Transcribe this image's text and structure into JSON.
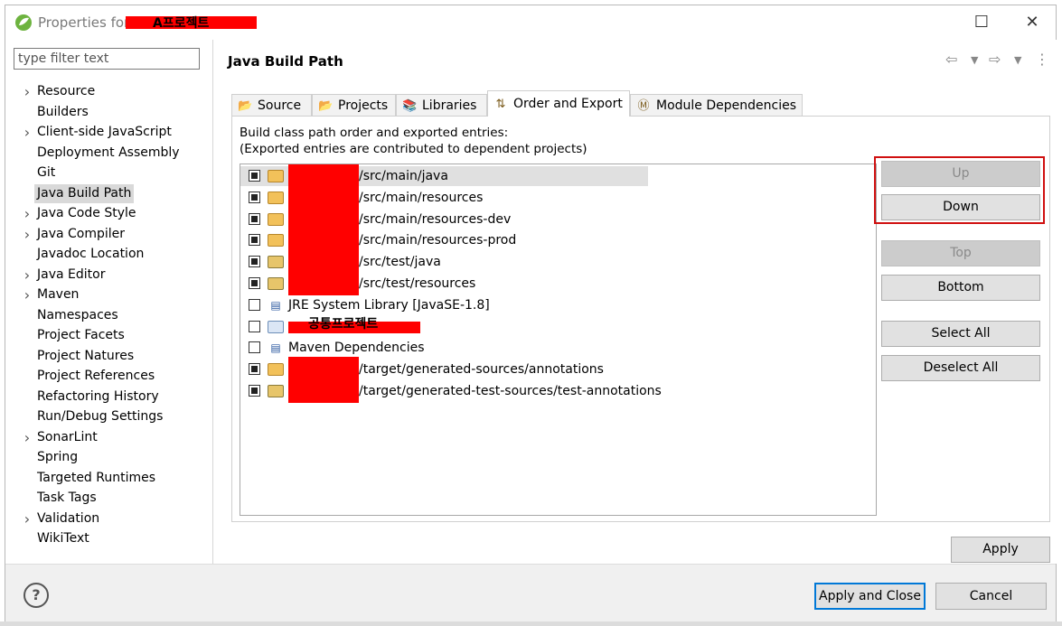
{
  "window": {
    "title_prefix": "Properties for",
    "title_project": "A프로젝트",
    "maximize_icon": "maximize-icon",
    "close_icon": "close-icon"
  },
  "filter": {
    "placeholder": "type filter text"
  },
  "nav": [
    {
      "label": "Resource",
      "expandable": true
    },
    {
      "label": "Builders",
      "expandable": false
    },
    {
      "label": "Client-side JavaScript",
      "expandable": true
    },
    {
      "label": "Deployment Assembly",
      "expandable": false
    },
    {
      "label": "Git",
      "expandable": false
    },
    {
      "label": "Java Build Path",
      "expandable": false,
      "selected": true
    },
    {
      "label": "Java Code Style",
      "expandable": true
    },
    {
      "label": "Java Compiler",
      "expandable": true
    },
    {
      "label": "Javadoc Location",
      "expandable": false
    },
    {
      "label": "Java Editor",
      "expandable": true
    },
    {
      "label": "Maven",
      "expandable": true
    },
    {
      "label": "Namespaces",
      "expandable": false
    },
    {
      "label": "Project Facets",
      "expandable": false
    },
    {
      "label": "Project Natures",
      "expandable": false
    },
    {
      "label": "Project References",
      "expandable": false
    },
    {
      "label": "Refactoring History",
      "expandable": false
    },
    {
      "label": "Run/Debug Settings",
      "expandable": false
    },
    {
      "label": "SonarLint",
      "expandable": true
    },
    {
      "label": "Spring",
      "expandable": false
    },
    {
      "label": "Targeted Runtimes",
      "expandable": false
    },
    {
      "label": "Task Tags",
      "expandable": false
    },
    {
      "label": "Validation",
      "expandable": true
    },
    {
      "label": "WikiText",
      "expandable": false
    }
  ],
  "page": {
    "title": "Java Build Path"
  },
  "tabs": [
    {
      "label": "Source",
      "icon": "source-folder-icon"
    },
    {
      "label": "Projects",
      "icon": "projects-icon"
    },
    {
      "label": "Libraries",
      "icon": "libraries-icon"
    },
    {
      "label": "Order and Export",
      "icon": "order-export-icon",
      "active": true
    },
    {
      "label": "Module Dependencies",
      "icon": "module-icon"
    }
  ],
  "order_export": {
    "desc1": "Build class path order and exported entries:",
    "desc2": "(Exported entries are contributed to dependent projects)",
    "entries": [
      {
        "text": "/src/main/java",
        "checked": true,
        "icon": "source-folder-icon",
        "redacted": true,
        "selected": true
      },
      {
        "text": "/src/main/resources",
        "checked": true,
        "icon": "source-folder-icon",
        "redacted": true
      },
      {
        "text": "/src/main/resources-dev",
        "checked": true,
        "icon": "source-folder-icon",
        "redacted": true
      },
      {
        "text": "/src/main/resources-prod",
        "checked": true,
        "icon": "source-folder-icon",
        "redacted": true
      },
      {
        "text": "/src/test/java",
        "checked": true,
        "icon": "test-source-folder-icon",
        "redacted": true
      },
      {
        "text": "/src/test/resources",
        "checked": true,
        "icon": "test-source-folder-icon",
        "redacted": true
      },
      {
        "text": "JRE System Library [JavaSE-1.8]",
        "checked": false,
        "icon": "library-icon",
        "redacted": false
      },
      {
        "text": "공통프로젝트",
        "checked": false,
        "icon": "project-folder-icon",
        "redacted": true,
        "label_over_redaction": true
      },
      {
        "text": "Maven Dependencies",
        "checked": false,
        "icon": "library-icon",
        "redacted": false
      },
      {
        "text": "/target/generated-sources/annotations",
        "checked": true,
        "icon": "source-folder-icon",
        "redacted": true
      },
      {
        "text": "/target/generated-test-sources/test-annotations",
        "checked": true,
        "icon": "test-source-folder-icon",
        "redacted": true
      }
    ],
    "buttons": {
      "up": "Up",
      "down": "Down",
      "top": "Top",
      "bottom": "Bottom",
      "select_all": "Select All",
      "deselect_all": "Deselect All"
    }
  },
  "footer": {
    "apply": "Apply",
    "apply_and_close": "Apply and Close",
    "cancel": "Cancel"
  },
  "colors": {
    "redaction": "#ff0000",
    "highlight": "#d01010",
    "default_button_border": "#0078d7"
  }
}
